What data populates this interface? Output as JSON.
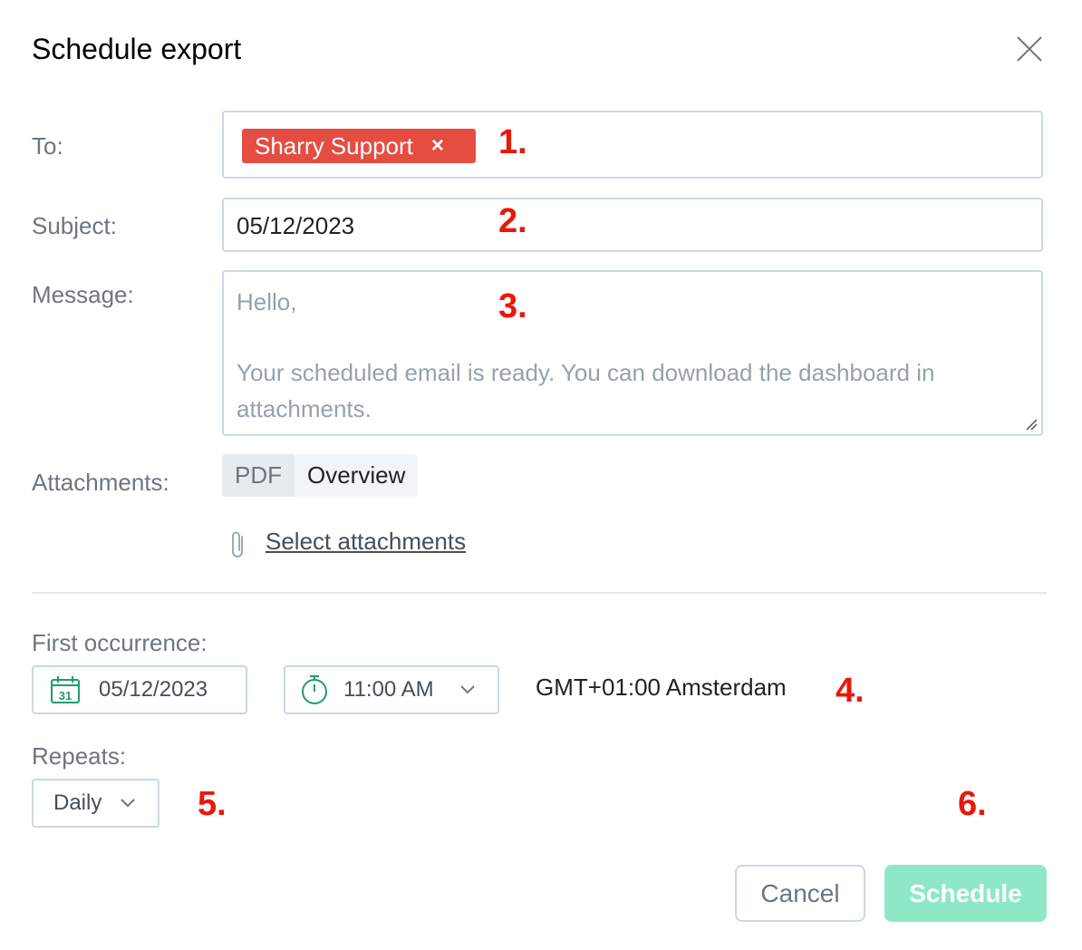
{
  "dialog": {
    "title": "Schedule export"
  },
  "form": {
    "to_label": "To:",
    "to_recipients": [
      {
        "name": "Sharry Support",
        "remove": "×"
      }
    ],
    "subject_label": "Subject:",
    "subject_value": "05/12/2023",
    "message_label": "Message:",
    "message_lines": [
      "Hello,",
      "Your scheduled email is ready. You can download the dashboard in",
      "attachments."
    ],
    "attachments_label": "Attachments:",
    "attachment": {
      "type": "PDF",
      "name": "Overview"
    },
    "select_attachments": "Select attachments"
  },
  "schedule": {
    "first_occurrence_label": "First occurrence:",
    "date": "05/12/2023",
    "calendar_day": "31",
    "time": "11:00 AM",
    "timezone": "GMT+01:00 Amsterdam",
    "repeats_label": "Repeats:",
    "repeats_value": "Daily"
  },
  "annotations": [
    "1.",
    "2.",
    "3.",
    "4.",
    "5.",
    "6."
  ],
  "buttons": {
    "cancel": "Cancel",
    "schedule": "Schedule"
  },
  "colors": {
    "chip": "#e54d42",
    "annotation": "#e8180a",
    "schedule_button": "#8ee8c6",
    "icon_green": "#1e9d6c"
  },
  "icons": {
    "close": "close-icon",
    "calendar": "calendar-icon",
    "clock": "stopwatch-icon",
    "chevron": "chevron-down-icon",
    "clip": "paperclip-icon"
  }
}
